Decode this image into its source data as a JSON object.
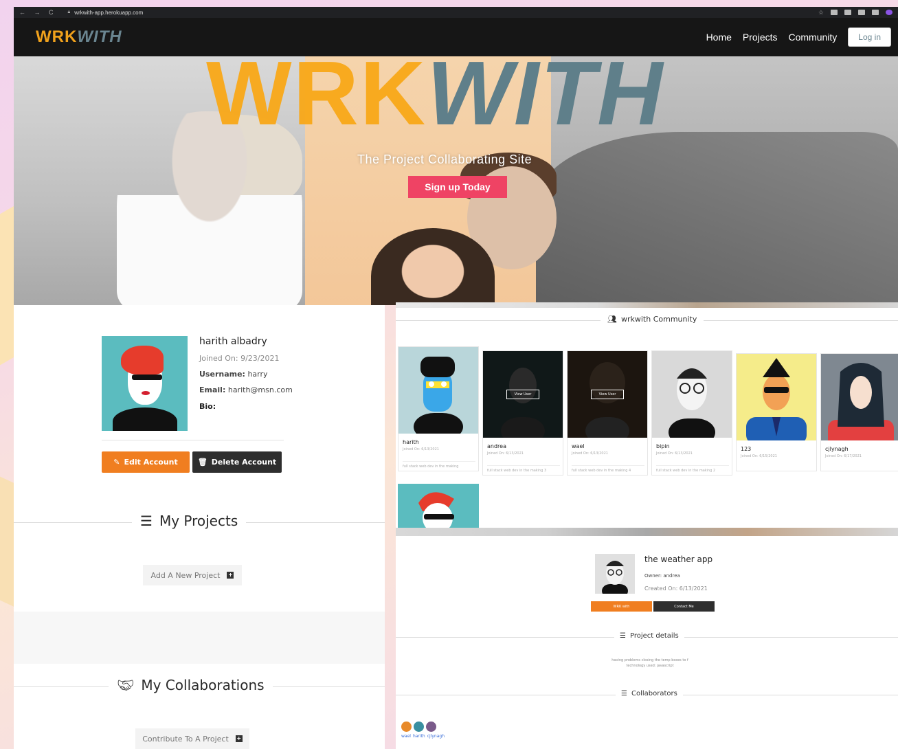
{
  "browser": {
    "url": "wrkwith-app.herokuapp.com"
  },
  "navbar": {
    "brand_wrk": "WRK",
    "brand_with": "WITH",
    "links": [
      "Home",
      "Projects",
      "Community"
    ],
    "login_label": "Log in"
  },
  "hero": {
    "logo_wrk": "WRK",
    "logo_with": "WITH",
    "tagline": "The Project Collaborating Site",
    "signup_label": "Sign up Today"
  },
  "profile": {
    "name": "harith albadry",
    "joined": "Joined On: 9/23/2021",
    "username_label": "Username:",
    "username": "harry",
    "email_label": "Email:",
    "email": "harith@msn.com",
    "bio_label": "Bio:",
    "edit_label": "Edit Account",
    "delete_label": "Delete Account"
  },
  "my_projects": {
    "title": "My Projects",
    "add_label": "Add A New Project"
  },
  "my_collaborations": {
    "title": "My Collaborations",
    "contribute_label": "Contribute To A Project"
  },
  "community": {
    "title": "wrkwith Community",
    "view_label": "View User",
    "cards": [
      {
        "name": "harith",
        "joined": "Joined On: 6/13/2021",
        "bio": "full stack web dev in the making"
      },
      {
        "name": "andrea",
        "joined": "Joined On: 6/13/2021",
        "bio": "full stack web dev in the making 3"
      },
      {
        "name": "wael",
        "joined": "Joined On: 6/13/2021",
        "bio": "full stack web dev in the making 4"
      },
      {
        "name": "bipin",
        "joined": "Joined On: 6/13/2021",
        "bio": "full stack web dev in the making 2"
      },
      {
        "name": "123",
        "joined": "Joined On: 6/15/2021",
        "bio": ""
      },
      {
        "name": "cjlynagh",
        "joined": "Joined On: 6/17/2021",
        "bio": ""
      }
    ]
  },
  "project": {
    "title": "the weather app",
    "owner": "Owner: andrea",
    "created": "Created On: 6/13/2021",
    "wrk_label": "WRK with",
    "contact_label": "Contact Me",
    "details_title": "Project details",
    "details_line1": "having problems closing the temp boxes to f",
    "details_line2": "technology used: javascript",
    "collaborators_title": "Collaborators",
    "collaborators": [
      "wael",
      "harith",
      "cjlynagh"
    ]
  },
  "colors": {
    "accent_orange": "#f07e20",
    "brand_yellow": "#f9a818",
    "brand_slate": "#5f7f8a",
    "signup_pink": "#ef4364",
    "dark": "#2e2e2e"
  }
}
